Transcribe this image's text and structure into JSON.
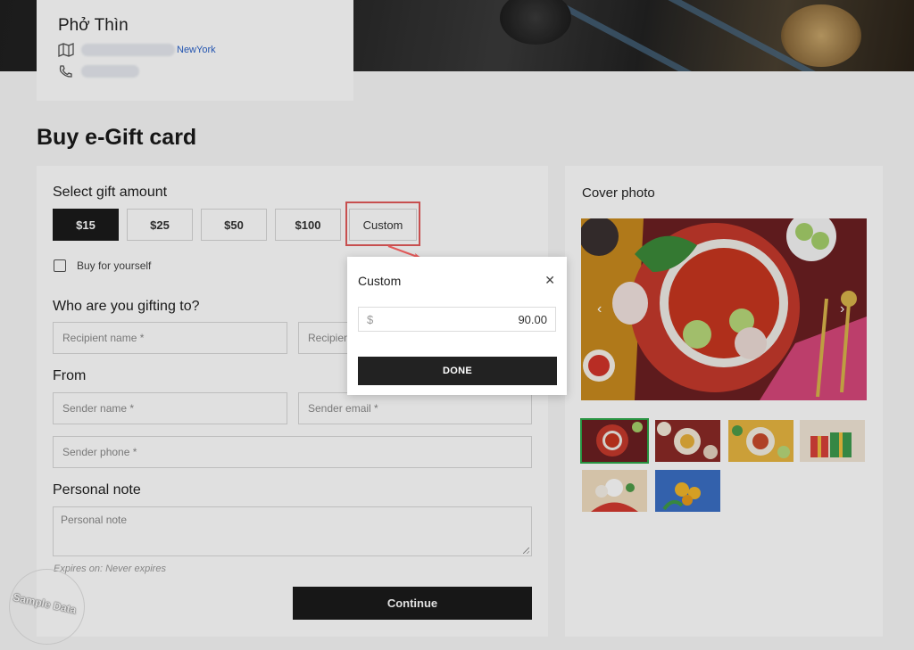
{
  "restaurant": {
    "name": "Phở Thìn",
    "address_city": "NewYork"
  },
  "page": {
    "title": "Buy e-Gift card"
  },
  "gift": {
    "select_amount_heading": "Select gift amount",
    "amounts": [
      "$15",
      "$25",
      "$50",
      "$100"
    ],
    "custom_label": "Custom",
    "selected_amount": "$15",
    "buy_for_yourself_label": "Buy for yourself"
  },
  "recipient": {
    "heading": "Who are you gifting to?",
    "name_placeholder": "Recipient name *",
    "email_placeholder": "Recipient email *"
  },
  "sender": {
    "heading": "From",
    "name_placeholder": "Sender name *",
    "email_placeholder": "Sender email *",
    "phone_placeholder": "Sender phone *"
  },
  "note": {
    "heading": "Personal note",
    "placeholder": "Personal note",
    "expires": "Expires on: Never expires"
  },
  "continue_label": "Continue",
  "watermark": "Sample Data",
  "cover": {
    "heading": "Cover photo",
    "thumbnails": [
      "pho-bowl",
      "dishes",
      "platter",
      "gift-boxes",
      "flowers-food",
      "yellow-flowers"
    ],
    "selected_thumbnail": "pho-bowl"
  },
  "modal": {
    "title": "Custom",
    "currency": "$",
    "value": "90.00",
    "done_label": "DONE"
  },
  "colors": {
    "primary": "#1b1b1b",
    "highlight": "#e35a5a",
    "link": "#2b62c9",
    "thumb_selected": "#2ea84b"
  }
}
